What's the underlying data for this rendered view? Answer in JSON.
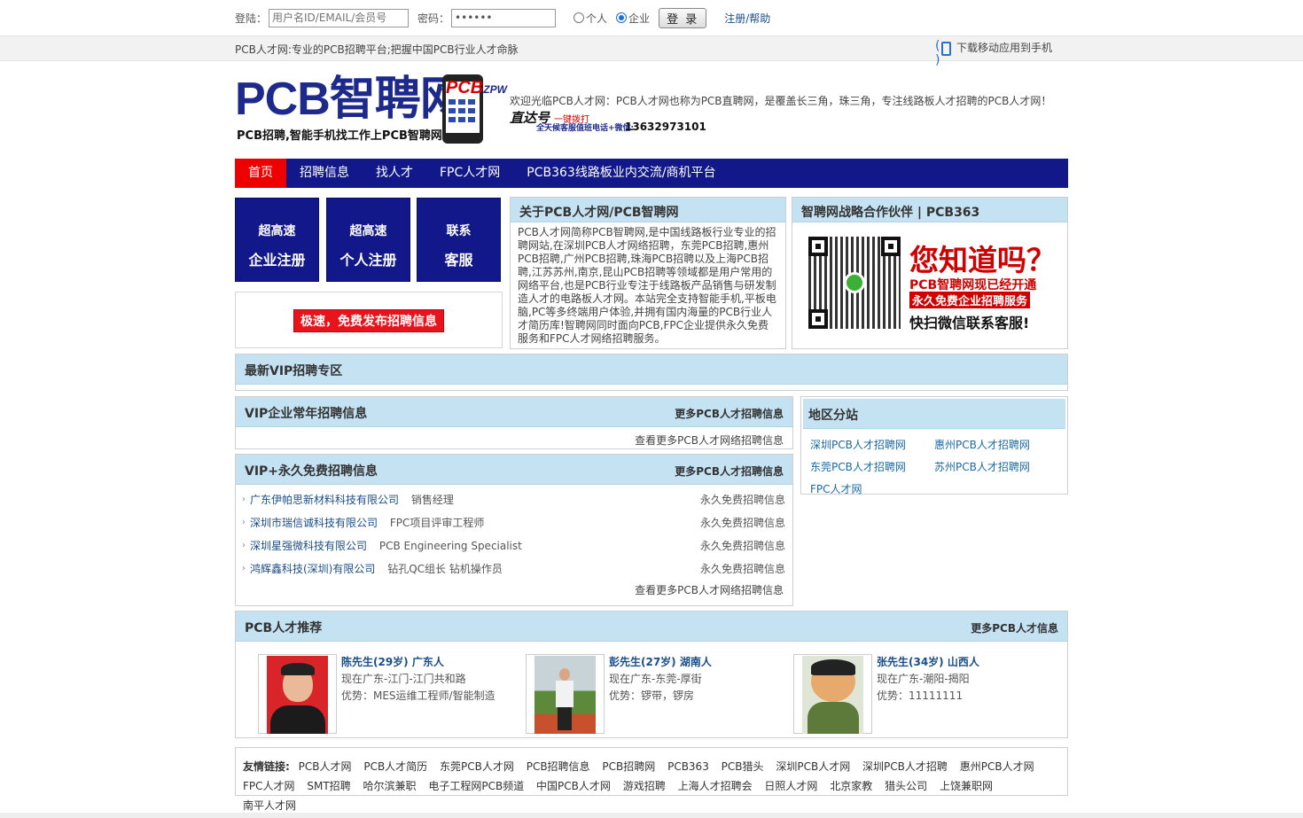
{
  "login": {
    "user_label": "登陆：",
    "user_placeholder": "用户名ID/EMAIL/会员号",
    "pwd_label": "密码：",
    "pwd_value": "••••••",
    "radio_personal": "个人",
    "radio_company": "企业",
    "login_button": "登 录",
    "register_help": "注册/帮助"
  },
  "strip": {
    "slogan": "PCB人才网:专业的PCB招聘平台;把握中国PCB行业人才命脉",
    "mobile": "下载移动应用到手机"
  },
  "header": {
    "logo_main": "PCB智聘网",
    "logo_sub": "PCB招聘,智能手机找工作上PCB智聘网",
    "logo_brand": "PCB",
    "logo_brand_small": "ZPW",
    "welcome": "欢迎光临PCB人才网：PCB人才网也称为PCB直聘网，是覆盖长三角，珠三角，专注线路板人才招聘的PCB人才网！",
    "hotline_title": "直达号",
    "hotline_one_click": "一键拨打",
    "hotline_service": "全天候客服值班电话+微信:",
    "hotline_number": "13632973101"
  },
  "nav": [
    "首页",
    "招聘信息",
    "找人才",
    "FPC人才网",
    "PCB363线路板业内交流/商机平台"
  ],
  "reg_boxes": [
    {
      "l1": "超高速",
      "l2": "企业注册"
    },
    {
      "l1": "超高速",
      "l2": "个人注册"
    },
    {
      "l1": "联系",
      "l2": "客服"
    }
  ],
  "publish_button": "极速，免费发布招聘信息",
  "about": {
    "title": "关于PCB人才网/PCB智聘网",
    "text": "PCB人才网简称PCB智聘网,是中国线路板行业专业的招聘网站,在深圳PCB人才网络招聘，东莞PCB招聘,惠州PCB招聘,广州PCB招聘,珠海PCB招聘以及上海PCB招聘,江苏苏州,南京,昆山PCB招聘等领域都是用户常用的网络平台,也是PCB行业专注于线路板产品销售与研发制造人才的电路板人才网。本站完全支持智能手机,平板电脑,PC等多终端用户体验,并拥有国内海量的PCB行业人才简历库!智聘网同时面向PCB,FPC企业提供永久免费服务和FPC人才网络招聘服务。"
  },
  "partner": {
    "title": "智聘网战略合作伙伴 | PCB363",
    "ad_title": "您知道吗？",
    "ad_line1": "PCB智聘网现已经开通",
    "ad_line2": "永久免费企业招聘服务",
    "ad_line3": "快扫微信联系客服!"
  },
  "vip_zone": {
    "title": "最新VIP招聘专区"
  },
  "vip_annual": {
    "title": "VIP企业常年招聘信息",
    "more": "更多PCB人才招聘信息",
    "more_line": "查看更多PCB人才网络招聘信息"
  },
  "vip_free": {
    "title": "VIP+永久免费招聘信息",
    "more": "更多PCB人才招聘信息",
    "rows": [
      {
        "company": "广东伊帕思新材料科技有限公司",
        "position": "销售经理",
        "tag": "永久免费招聘信息"
      },
      {
        "company": "深圳市瑞信诚科技有限公司",
        "position": "FPC项目评审工程师",
        "tag": "永久免费招聘信息"
      },
      {
        "company": "深圳星强微科技有限公司",
        "position": "PCB Engineering Specialist",
        "tag": "永久免费招聘信息"
      },
      {
        "company": "鸿辉鑫科技(深圳)有限公司",
        "position": "钻孔QC组长 钻机操作员",
        "tag": "永久免费招聘信息"
      }
    ],
    "more_line": "查看更多PCB人才网络招聘信息"
  },
  "regions": {
    "title": "地区分站",
    "items": [
      "深圳PCB人才招聘网",
      "惠州PCB人才招聘网",
      "东莞PCB人才招聘网",
      "苏州PCB人才招聘网",
      "FPC人才网"
    ]
  },
  "talents": {
    "title": "PCB人才推荐",
    "more": "更多PCB人才信息",
    "items": [
      {
        "name": "陈先生(29岁) 广东人",
        "location": "现在广东-江门-江门共和路",
        "advantage": "优势：MES运维工程师/智能制造"
      },
      {
        "name": "彭先生(27岁) 湖南人",
        "location": "现在广东-东莞-厚街",
        "advantage": "优势：锣带，锣房"
      },
      {
        "name": "张先生(34岁) 山西人",
        "location": "现在广东-潮阳-揭阳",
        "advantage": "优势：11111111"
      }
    ]
  },
  "friend_links": {
    "label": "友情链接:",
    "items": [
      "PCB人才网",
      "PCB人才简历",
      "东莞PCB人才网",
      "PCB招聘信息",
      "PCB招聘网",
      "PCB363",
      "PCB猎头",
      "深圳PCB人才网",
      "深圳PCB人才招聘",
      "惠州PCB人才网",
      "FPC人才网",
      "SMT招聘",
      "哈尔滨兼职",
      "电子工程网PCB频道",
      "中国PCB人才网",
      "游戏招聘",
      "上海人才招聘会",
      "日照人才网",
      "北京家教",
      "猎头公司",
      "上饶兼职网",
      "南平人才网"
    ]
  },
  "colors": {
    "nav_bg": "#12178a",
    "nav_active": "#ee0000",
    "panel_head": "#c5e2f3",
    "publish": "#e8131b"
  }
}
